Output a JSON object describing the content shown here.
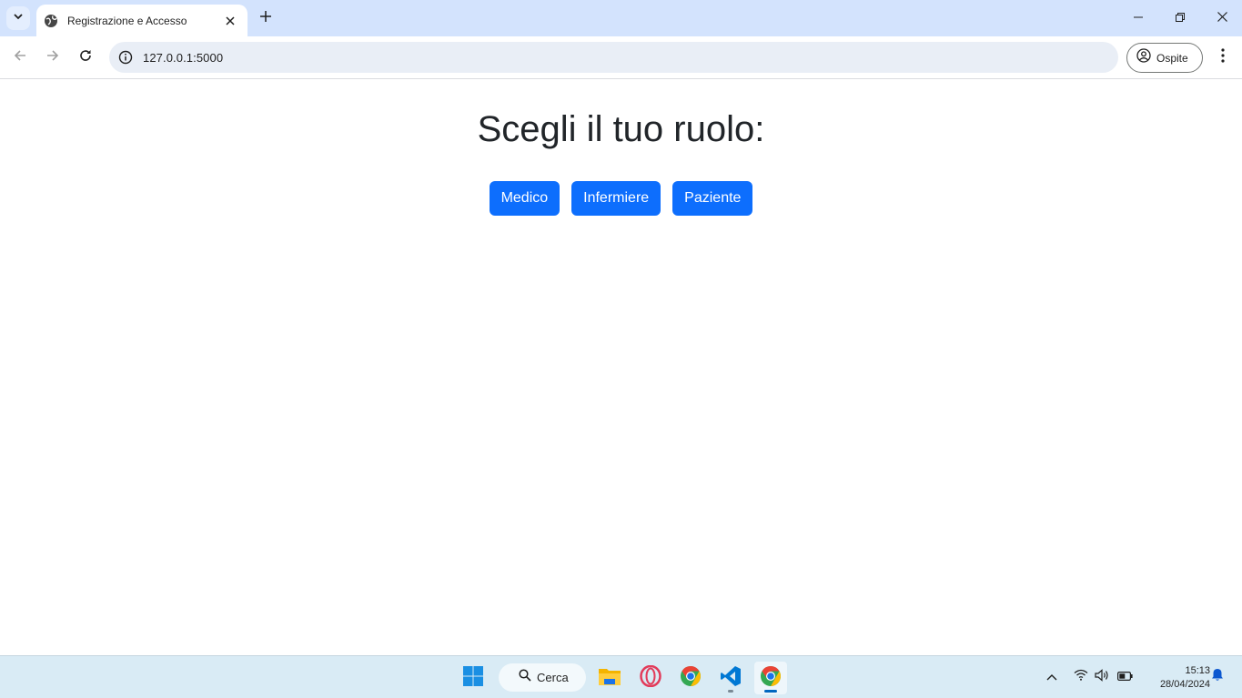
{
  "browser": {
    "tab_title": "Registrazione e Accesso",
    "url": "127.0.0.1:5000",
    "profile_label": "Ospite"
  },
  "page": {
    "title": "Scegli il tuo ruolo:",
    "buttons": [
      {
        "label": "Medico"
      },
      {
        "label": "Infermiere"
      },
      {
        "label": "Paziente"
      }
    ],
    "button_color": "#0d6efd"
  },
  "taskbar": {
    "search_label": "Cerca",
    "apps": [
      "windows-start",
      "file-explorer",
      "opera",
      "chrome",
      "vscode",
      "chrome"
    ],
    "time": "15:13",
    "date": "28/04/2024"
  }
}
